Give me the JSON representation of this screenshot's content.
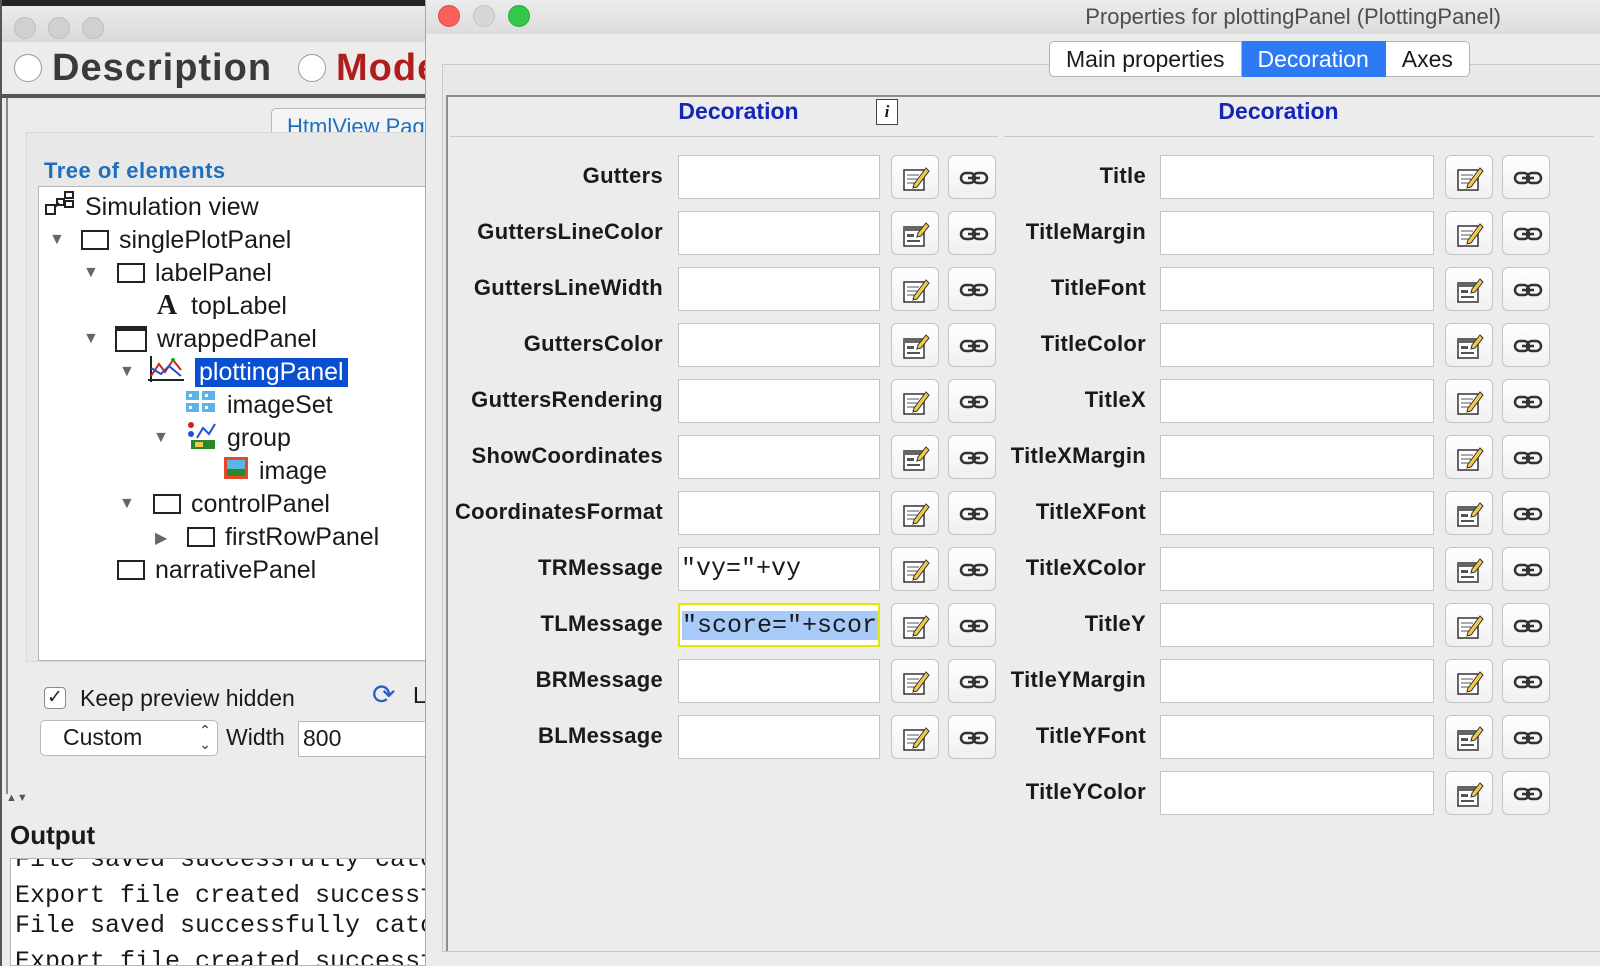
{
  "bg_window": {
    "radios": [
      {
        "label": "Description",
        "color": "#3a3a3a"
      },
      {
        "label": "Mode",
        "color": "#b01d1d"
      }
    ],
    "htmlview_tab": "HtmlView Pag",
    "tree_title": "Tree of elements",
    "tree": [
      {
        "label": "Simulation view",
        "icon": "simulation-view-icon"
      },
      {
        "label": "singlePlotPanel",
        "icon": "panel-icon",
        "expanded": true
      },
      {
        "label": "labelPanel",
        "icon": "panel-icon",
        "expanded": true
      },
      {
        "label": "topLabel",
        "icon": "label-icon"
      },
      {
        "label": "wrappedPanel",
        "icon": "window-icon",
        "expanded": true
      },
      {
        "label": "plottingPanel",
        "icon": "plotting-panel-icon",
        "expanded": true,
        "selected": true
      },
      {
        "label": "imageSet",
        "icon": "image-set-icon"
      },
      {
        "label": "group",
        "icon": "group-icon",
        "expanded": true
      },
      {
        "label": "image",
        "icon": "image-icon"
      },
      {
        "label": "controlPanel",
        "icon": "panel-icon",
        "expanded": true
      },
      {
        "label": "firstRowPanel",
        "icon": "panel-icon",
        "expanded": false
      },
      {
        "label": "narrativePanel",
        "icon": "panel-icon"
      }
    ],
    "keep_preview_label": "Keep preview hidden",
    "keep_preview_checked": true,
    "reload_label": "La",
    "size_select_value": "Custom",
    "width_label": "Width",
    "width_value": "800",
    "output_title": "Output",
    "output_lines": [
      "File saved successfully catcha",
      "Export file created successful",
      "File saved successfully catcha",
      "Export file created successful"
    ]
  },
  "props_window": {
    "title": "Properties for plottingPanel (PlottingPanel)",
    "tabs": [
      {
        "label": "Main properties",
        "active": false
      },
      {
        "label": "Decoration",
        "active": true
      },
      {
        "label": "Axes",
        "active": false
      }
    ],
    "left_header": "Decoration",
    "right_header": "Decoration",
    "left_props": [
      {
        "label": "Gutters",
        "value": "",
        "editor": "edit"
      },
      {
        "label": "GuttersLineColor",
        "value": "",
        "editor": "dialog"
      },
      {
        "label": "GuttersLineWidth",
        "value": "",
        "editor": "edit"
      },
      {
        "label": "GuttersColor",
        "value": "",
        "editor": "dialog"
      },
      {
        "label": "GuttersRendering",
        "value": "",
        "editor": "edit"
      },
      {
        "label": "ShowCoordinates",
        "value": "",
        "editor": "dialog"
      },
      {
        "label": "CoordinatesFormat",
        "value": "",
        "editor": "edit"
      },
      {
        "label": "TRMessage",
        "value": "\"vy=\"+vy",
        "editor": "edit"
      },
      {
        "label": "TLMessage",
        "value": "\"score=\"+score",
        "editor": "edit",
        "focused": true
      },
      {
        "label": "BRMessage",
        "value": "",
        "editor": "edit"
      },
      {
        "label": "BLMessage",
        "value": "",
        "editor": "edit"
      }
    ],
    "right_props": [
      {
        "label": "Title",
        "value": "",
        "editor": "edit"
      },
      {
        "label": "TitleMargin",
        "value": "",
        "editor": "edit"
      },
      {
        "label": "TitleFont",
        "value": "",
        "editor": "dialog"
      },
      {
        "label": "TitleColor",
        "value": "",
        "editor": "dialog"
      },
      {
        "label": "TitleX",
        "value": "",
        "editor": "edit"
      },
      {
        "label": "TitleXMargin",
        "value": "",
        "editor": "edit"
      },
      {
        "label": "TitleXFont",
        "value": "",
        "editor": "dialog"
      },
      {
        "label": "TitleXColor",
        "value": "",
        "editor": "dialog"
      },
      {
        "label": "TitleY",
        "value": "",
        "editor": "edit"
      },
      {
        "label": "TitleYMargin",
        "value": "",
        "editor": "edit"
      },
      {
        "label": "TitleYFont",
        "value": "",
        "editor": "dialog"
      },
      {
        "label": "TitleYColor",
        "value": "",
        "editor": "dialog"
      }
    ]
  },
  "colors": {
    "selection_blue": "#0a4fd1",
    "tab_active": "#2d7bf4",
    "header_blue": "#1426b8",
    "focus_yellow": "#e7e600"
  }
}
